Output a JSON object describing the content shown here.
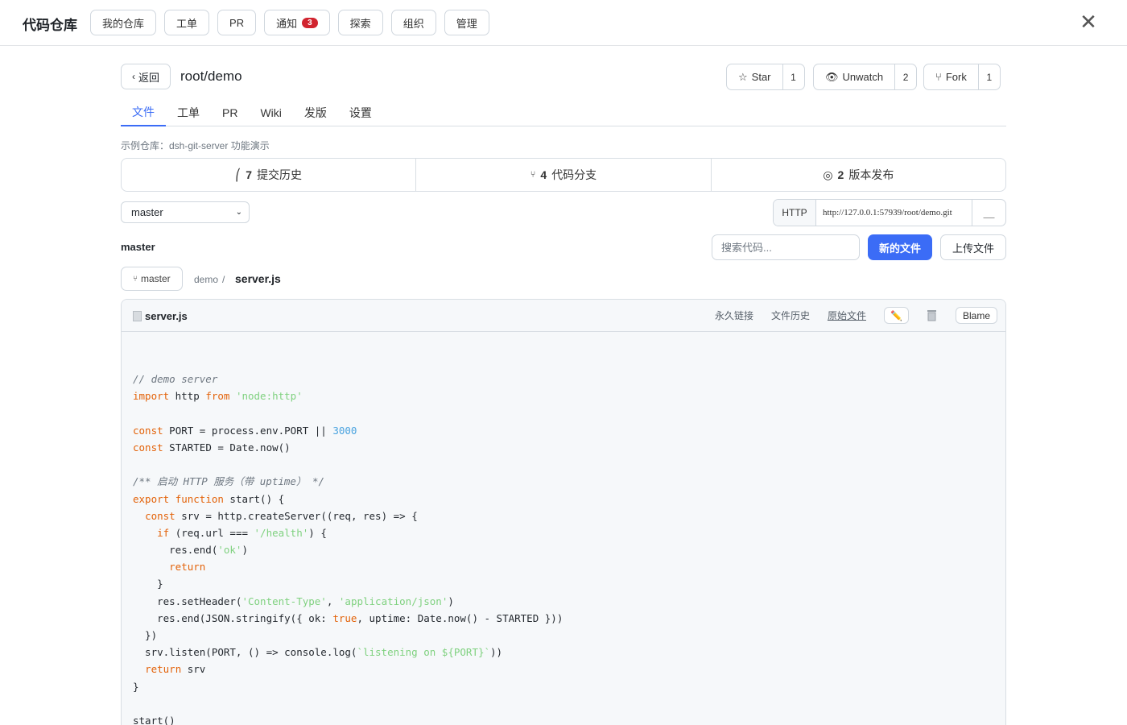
{
  "nav": {
    "brand": "代码仓库",
    "items": [
      "我的仓库",
      "工单",
      "PR",
      "通知",
      "探索",
      "组织",
      "管理"
    ],
    "notify_badge": "3",
    "close": "✕"
  },
  "repo": {
    "back_label": "返回",
    "name": "root/demo",
    "star_label": "Star",
    "star_count": "1",
    "watch_label": "Unwatch",
    "watch_count": "2",
    "fork_label": "Fork",
    "fork_count": "1"
  },
  "tabs": [
    "文件",
    "工单",
    "PR",
    "Wiki",
    "发版",
    "设置"
  ],
  "active_tab": "文件",
  "description": "示例仓库：dsh-git-server 功能演示",
  "stats": {
    "commits_count": "7",
    "commits_label": "提交历史",
    "branches_count": "4",
    "branches_label": "代码分支",
    "releases_count": "2",
    "releases_label": "版本发布"
  },
  "branch_select": "master",
  "clone": {
    "protocol": "HTTP",
    "url": "http://127.0.0.1:57939/root/demo.git"
  },
  "branch_title": "master",
  "search": {
    "placeholder": "搜索代码..."
  },
  "new_file_label": "新的文件",
  "upload_label": "上传文件",
  "breadcrumb": {
    "branch": "master",
    "dir": "demo",
    "sep": "/",
    "file": "server.js"
  },
  "file": {
    "name": "server.js",
    "permalink": "永久链接",
    "history": "文件历史",
    "raw": "原始文件",
    "blame": "Blame"
  },
  "code_lines": [
    "// demo server",
    "import http from 'node:http'",
    "",
    "const PORT = process.env.PORT || 3000",
    "const STARTED = Date.now()",
    "",
    "/** 启动 HTTP 服务（带 uptime） */",
    "export function start() {",
    "  const srv = http.createServer((req, res) => {",
    "    if (req.url === '/health') {",
    "      res.end('ok')",
    "      return",
    "    }",
    "    res.setHeader('Content-Type', 'application/json')",
    "    res.end(JSON.stringify({ ok: true, uptime: Date.now() - STARTED }))",
    "  })",
    "  srv.listen(PORT, () => console.log(`listening on ${PORT}`))",
    "  return srv",
    "}",
    "",
    "start()"
  ],
  "colors": {
    "accent": "#3b6cf6",
    "keyword": "#e36209",
    "string": "#7fd17f",
    "number": "#4aa3df",
    "badge": "#d1242f"
  }
}
